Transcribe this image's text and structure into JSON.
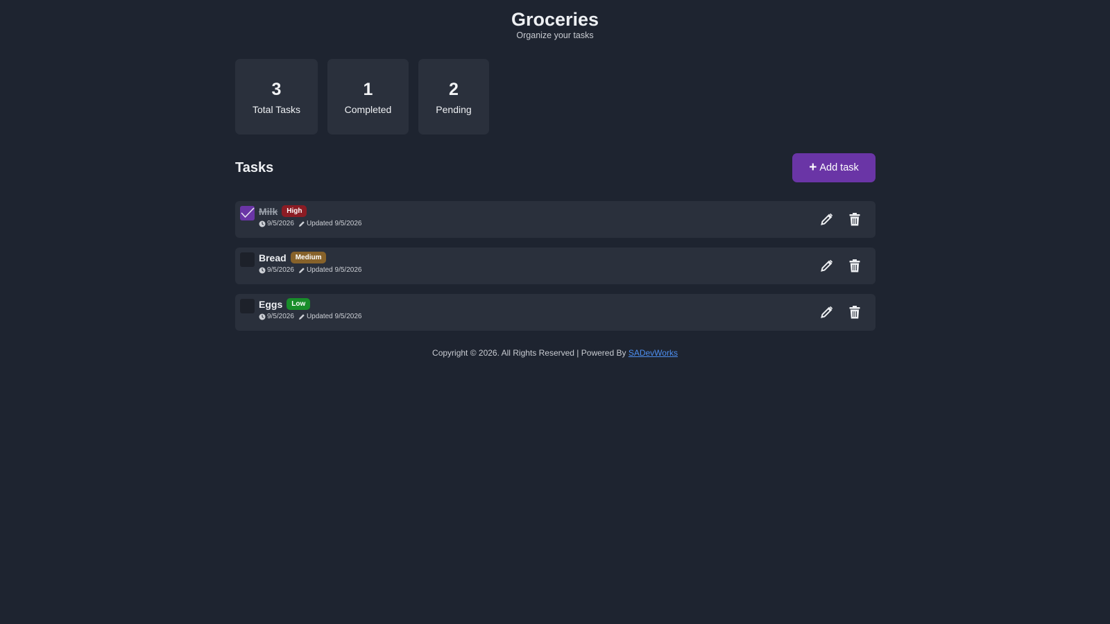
{
  "header": {
    "title": "Groceries",
    "subtitle": "Organize your tasks"
  },
  "stats": [
    {
      "value": "3",
      "label": "Total Tasks"
    },
    {
      "value": "1",
      "label": "Completed"
    },
    {
      "value": "2",
      "label": "Pending"
    }
  ],
  "tasks_section": {
    "title": "Tasks",
    "add_label": "Add task"
  },
  "tasks": [
    {
      "name": "Milk",
      "completed": true,
      "priority": "High",
      "priority_color": "#8b1c24",
      "created": "9/5/2026",
      "updated": "Updated 9/5/2026"
    },
    {
      "name": "Bread",
      "completed": false,
      "priority": "Medium",
      "priority_color": "#87622a",
      "created": "9/5/2026",
      "updated": "Updated 9/5/2026"
    },
    {
      "name": "Eggs",
      "completed": false,
      "priority": "Low",
      "priority_color": "#188d2a",
      "created": "9/5/2026",
      "updated": "Updated 9/5/2026"
    }
  ],
  "footer": {
    "text": "Copyright © 2026. All Rights Reserved | Powered By",
    "link_text": "SADevWorks"
  },
  "colors": {
    "background": "#1e2430",
    "card": "#2a303c",
    "accent": "#6a35a6",
    "link": "#4d8ff0"
  },
  "icons": {
    "checkmark": "check-icon",
    "clock": "clock-icon",
    "pencil": "pencil-icon",
    "edit": "edit-icon",
    "delete": "trash-icon",
    "add": "plus-icon"
  }
}
